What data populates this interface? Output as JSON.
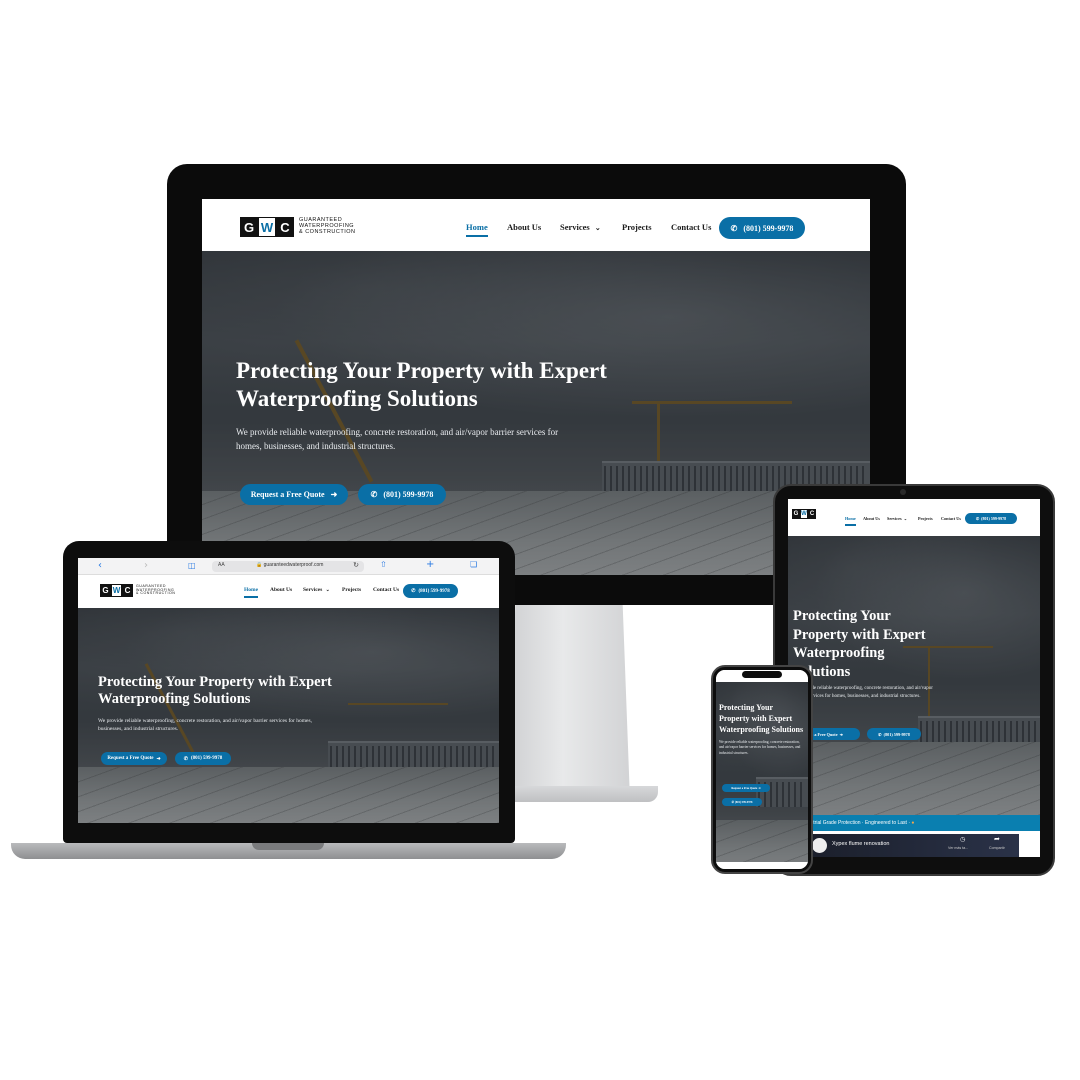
{
  "brand": {
    "logo_letters": [
      "G",
      "W",
      "C"
    ],
    "tagline_lines": [
      "GUARANTEED",
      "WATERPROOFING",
      "& CONSTRUCTION"
    ],
    "accent_color": "#0a6fa6",
    "nav_text_color": "#1a1a1a"
  },
  "nav": {
    "items": [
      "Home",
      "About Us",
      "Services",
      "Projects",
      "Contact Us"
    ],
    "active_item": "Home",
    "services_chevron_icon": "chevron-down-icon",
    "phone_button_label": "(801) 599-9978",
    "phone_icon": "phone-icon"
  },
  "hero": {
    "title": "Protecting Your Property with Expert Waterproofing Solutions",
    "description": "We provide reliable waterproofing, concrete restoration, and air/vapor barrier services for homes, businesses, and industrial structures.",
    "primary_button_label": "Request a Free Quote",
    "primary_button_icon": "arrow-right-icon",
    "secondary_button_label": "(801) 599-9978"
  },
  "browser": {
    "url": "guaranteedwaterproof.com",
    "text_size_label": "AA"
  },
  "tablet_extras": {
    "banner_text": "ustrial Grade Protection · Engineered to Last ·",
    "video_title": "Xypex flume renovation",
    "video_watch_label": "Ver más ta...",
    "video_share_label": "Compartir"
  }
}
